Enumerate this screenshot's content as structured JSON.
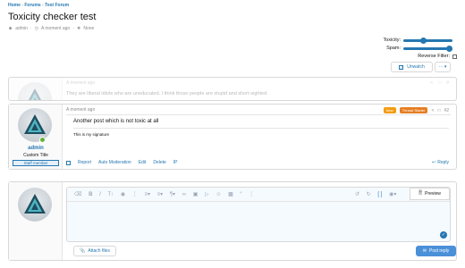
{
  "breadcrumb": [
    "Home",
    "Forums",
    "Test Forum"
  ],
  "page_title": "Toxicity checker test",
  "thread_meta": {
    "author": "admin",
    "time": "A moment ago",
    "tags": "None"
  },
  "controls": {
    "toxicity_label": "Toxicity:",
    "toxicity_value": 0.4,
    "spam_label": "Spam:",
    "spam_value": 1.0,
    "reverse_label": "Reverse Filter:",
    "unwatch_label": "Unwatch",
    "more_label": "··· ▾"
  },
  "post1": {
    "time": "A moment ago",
    "text": "They are liberal idiots who are uneducated. I think those people are stupid and short-sighted."
  },
  "post2": {
    "username": "admin",
    "user_title": "Custom Title",
    "staff_label": "Staff member",
    "time": "A moment ago",
    "badge_new": "New",
    "badge_starter": "Thread Starter",
    "post_number": "#2",
    "text": "Another post which is not toxic at all",
    "signature": "This is my signature",
    "actions": [
      "Report",
      "Auto Moderation",
      "Edit",
      "Delete",
      "IP"
    ],
    "reply_label": "Reply"
  },
  "editor": {
    "preview_label": "Preview",
    "attach_label": "Attach files",
    "post_reply_label": "Post reply"
  },
  "colors": {
    "accent": "#2577b1",
    "new_badge": "#f39c12",
    "starter_badge": "#e67e22",
    "staff": "#2577b1"
  }
}
